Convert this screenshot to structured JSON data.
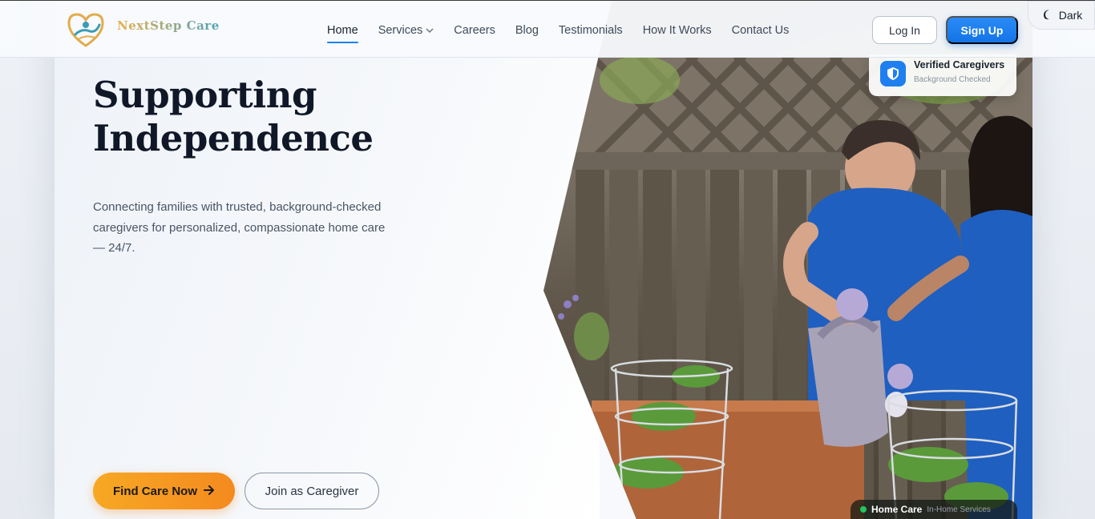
{
  "brand": {
    "name": "NextStep Care",
    "accent_color": "#1d7ff0",
    "cta_color": "#f7a824"
  },
  "nav": {
    "items": [
      {
        "label": "Home",
        "active": true
      },
      {
        "label": "Services",
        "has_dropdown": true
      },
      {
        "label": "Careers"
      },
      {
        "label": "Blog"
      },
      {
        "label": "Testimonials"
      },
      {
        "label": "How It Works"
      },
      {
        "label": "Contact Us"
      }
    ]
  },
  "auth": {
    "login_label": "Log In",
    "signup_label": "Sign Up"
  },
  "theme_toggle": {
    "label": "Dark",
    "icon": "moon-icon"
  },
  "hero": {
    "title_line1": "Supporting",
    "title_line2": "Independence",
    "description": "Connecting families with trusted, background-checked caregivers for personalized, compassionate home care — 24/7.",
    "primary_cta": "Find Care Now",
    "primary_cta_icon": "arrow-right-icon",
    "secondary_cta": "Join as Caregiver"
  },
  "badges": {
    "verified_title": "Verified Caregivers",
    "verified_subtitle": "Background Checked",
    "verified_icon": "shield-icon",
    "homecare_title": "Home Care",
    "homecare_subtitle": "In-Home Services",
    "status_color": "#22c55e"
  }
}
